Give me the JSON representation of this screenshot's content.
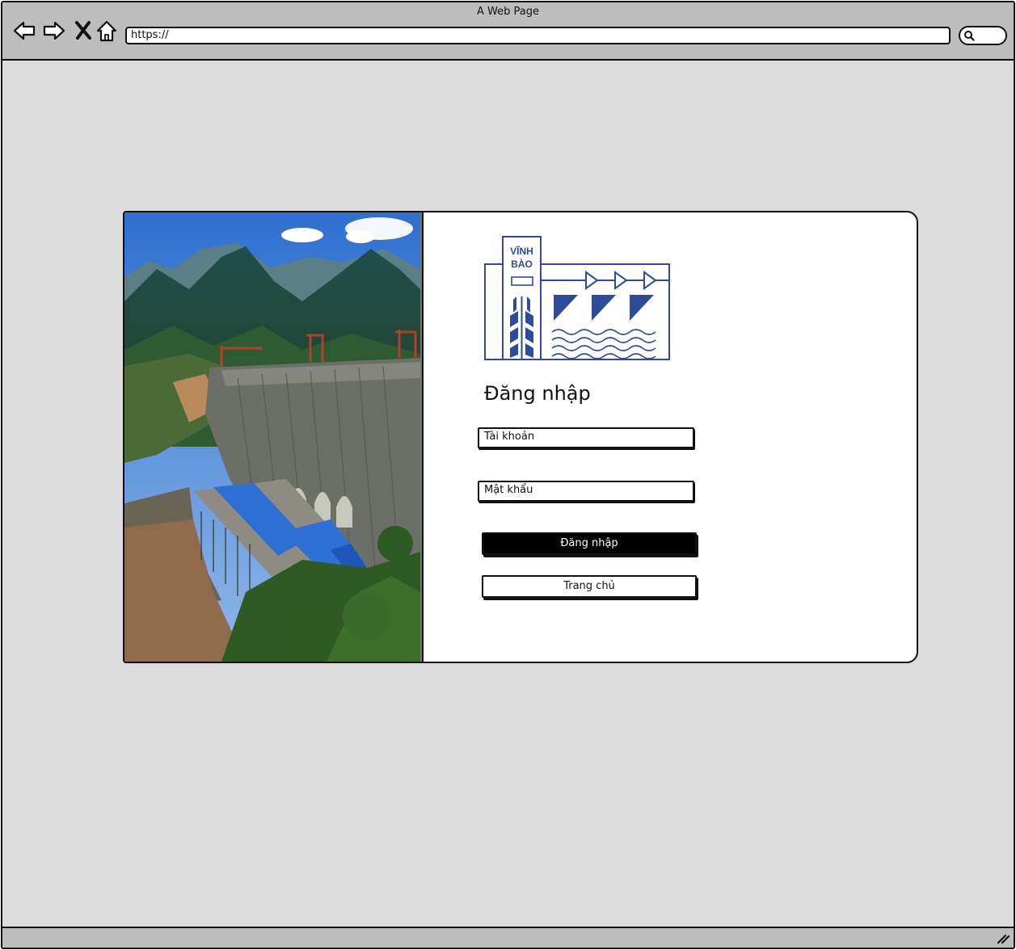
{
  "browser": {
    "title": "A Web Page",
    "url": "https://",
    "icons": [
      "back-arrow-icon",
      "forward-arrow-icon",
      "close-icon",
      "home-icon",
      "search-icon",
      "resize-grip-icon"
    ]
  },
  "login": {
    "logo_line1": "VĨNH",
    "logo_line2": "BÀO",
    "heading": "Đăng nhập",
    "username_placeholder": "Tài khoản",
    "password_placeholder": "Mật khẩu",
    "login_button": "Đăng nhập",
    "home_button": "Trang chủ"
  },
  "colors": {
    "logo_blue": "#2e4a9b",
    "button_primary_bg": "#000000",
    "window_bg": "#dcdcdc",
    "chrome_bg": "#bdbdbd"
  }
}
